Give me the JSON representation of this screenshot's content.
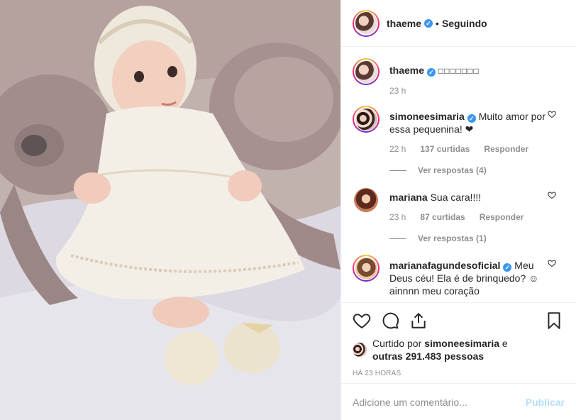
{
  "post": {
    "author": "thaeme",
    "following_label": "Seguindo",
    "separator": "•",
    "caption_text": "□□□□□□□",
    "caption_time": "23 h"
  },
  "comments": [
    {
      "user": "simoneesimaria",
      "verified": true,
      "text": "Muito amor por essa pequenina! ❤",
      "time": "22 h",
      "likes": "137 curtidas",
      "reply": "Responder",
      "view_replies": "Ver respostas (4)"
    },
    {
      "user": "mariana",
      "verified": false,
      "text": "Sua cara!!!!",
      "time": "23 h",
      "likes": "87 curtidas",
      "reply": "Responder",
      "view_replies": "Ver respostas (1)"
    },
    {
      "user": "marianafagundesoficial",
      "verified": true,
      "text": "Meu Deus céu! Ela é de brinquedo? ☺ ainnnn meu coração"
    }
  ],
  "likes": {
    "prefix": "Curtido por",
    "by_user": "simoneesimaria",
    "connector": "e",
    "others": "outras 291.483 pessoas"
  },
  "timestamp": "HÁ 23 HORAS",
  "add_comment": {
    "placeholder": "Adicione um comentário...",
    "publish_label": "Publicar"
  },
  "icons": {
    "like": "heart-icon",
    "comment": "comment-bubble-icon",
    "share": "share-icon",
    "save": "bookmark-icon",
    "verified": "verified-badge-icon"
  },
  "colors": {
    "verified": "#3897f0",
    "publish_disabled": "#b2dffc",
    "muted": "#8e8e8e",
    "text": "#262626"
  }
}
